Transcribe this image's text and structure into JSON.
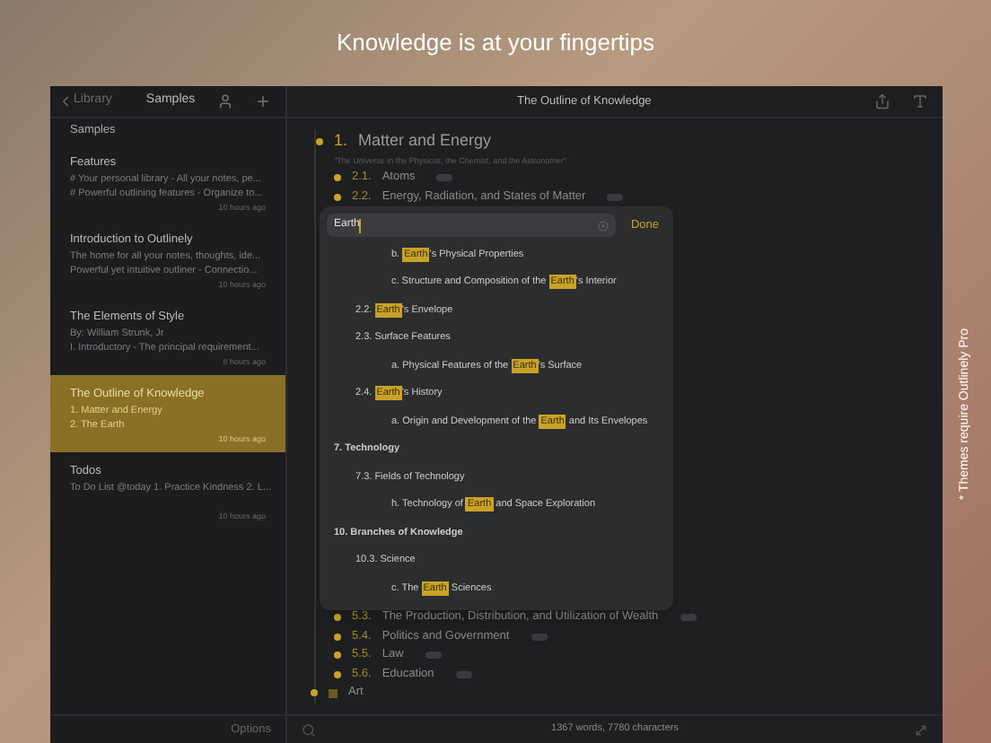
{
  "headline": "Knowledge is at your fingertips",
  "side_note": "* Themes require Outlinely Pro",
  "sidebar": {
    "back": "Library",
    "title": "Samples",
    "section": "Samples",
    "footer": "Options",
    "items": [
      {
        "title": "Features",
        "lines": [
          "# Your personal library - All your notes, pe...",
          "# Powerful outlining features - Organize to..."
        ],
        "time": "10 hours ago",
        "selected": false
      },
      {
        "title": "Introduction to Outlinely",
        "lines": [
          "The home for all your notes, thoughts, ide...",
          "Powerful yet intuitive outliner - Connectio..."
        ],
        "time": "10 hours ago",
        "selected": false
      },
      {
        "title": "The Elements of Style",
        "lines": [
          "By: William Strunk, Jr",
          "I. Introductory - The principal requirement..."
        ],
        "time": "8 hours ago",
        "selected": false
      },
      {
        "title": "The Outline of Knowledge",
        "lines": [
          "1. Matter and Energy",
          "2. The Earth"
        ],
        "time": "10 hours ago",
        "selected": true
      },
      {
        "title": "Todos",
        "lines": [
          "To Do List @today 1. Practice Kindness 2. L..."
        ],
        "time": "10 hours ago",
        "selected": false
      }
    ]
  },
  "document": {
    "title": "The Outline of Knowledge",
    "rows_top": [
      {
        "kind": "heading",
        "number": "1.",
        "text": "Matter and Energy"
      },
      {
        "kind": "note",
        "text": "\"The Universe in the Physicist, the Chemist, and the Astronomer\""
      },
      {
        "kind": "item",
        "number": "2.1.",
        "text": "Atoms",
        "collapsed": true
      },
      {
        "kind": "item",
        "number": "2.2.",
        "text": "Energy, Radiation, and States of Matter",
        "collapsed": true
      }
    ],
    "rows_bottom": [
      {
        "kind": "item",
        "number": "5.3.",
        "text": "The Production, Distribution, and Utilization of Wealth",
        "collapsed": true
      },
      {
        "kind": "item",
        "number": "5.4.",
        "text": "Politics and Government",
        "collapsed": true
      },
      {
        "kind": "item",
        "number": "5.5.",
        "text": "Law",
        "collapsed": true
      },
      {
        "kind": "item",
        "number": "5.6.",
        "text": "Education",
        "collapsed": true
      },
      {
        "kind": "top",
        "text": "Art"
      }
    ],
    "status": "1367 words, 7780 characters"
  },
  "search": {
    "value": "Earth",
    "done": "Done",
    "results": [
      {
        "kind": "entry",
        "parts": [
          {
            "text": "b. ",
            "match": false
          },
          {
            "text": "Earth",
            "match": true
          },
          {
            "text": "'s Physical Properties",
            "match": false
          }
        ]
      },
      {
        "kind": "entry",
        "parts": [
          {
            "text": "c. Structure and Composition of the ",
            "match": false
          },
          {
            "text": "Earth",
            "match": true
          },
          {
            "text": "'s Interior",
            "match": false
          }
        ]
      },
      {
        "kind": "subsection",
        "parts": [
          {
            "text": "2.2. ",
            "match": false
          },
          {
            "text": "Earth",
            "match": true
          },
          {
            "text": "'s Envelope",
            "match": false
          }
        ]
      },
      {
        "kind": "subsection",
        "parts": [
          {
            "text": "2.3. Surface Features",
            "match": false
          }
        ]
      },
      {
        "kind": "entry",
        "parts": [
          {
            "text": "a. Physical Features of the ",
            "match": false
          },
          {
            "text": "Earth",
            "match": true
          },
          {
            "text": "'s Surface",
            "match": false
          }
        ]
      },
      {
        "kind": "subsection",
        "parts": [
          {
            "text": "2.4. ",
            "match": false
          },
          {
            "text": "Earth",
            "match": true
          },
          {
            "text": "'s History",
            "match": false
          }
        ]
      },
      {
        "kind": "entry",
        "parts": [
          {
            "text": "a. Origin and Development of the ",
            "match": false
          },
          {
            "text": "Earth",
            "match": true
          },
          {
            "text": " and Its Envelopes",
            "match": false
          }
        ]
      },
      {
        "kind": "section",
        "parts": [
          {
            "text": "7. Technology",
            "match": false
          }
        ]
      },
      {
        "kind": "subsection",
        "parts": [
          {
            "text": "7.3. Fields of Technology",
            "match": false
          }
        ]
      },
      {
        "kind": "entry",
        "parts": [
          {
            "text": "h. Technology of ",
            "match": false
          },
          {
            "text": "Earth",
            "match": true
          },
          {
            "text": " and Space Exploration",
            "match": false
          }
        ]
      },
      {
        "kind": "section",
        "parts": [
          {
            "text": "10. Branches of Knowledge",
            "match": false
          }
        ]
      },
      {
        "kind": "subsection",
        "parts": [
          {
            "text": "10.3. Science",
            "match": false
          }
        ]
      },
      {
        "kind": "entry",
        "parts": [
          {
            "text": "c. The ",
            "match": false
          },
          {
            "text": "Earth",
            "match": true
          },
          {
            "text": " Sciences",
            "match": false
          }
        ]
      }
    ]
  }
}
